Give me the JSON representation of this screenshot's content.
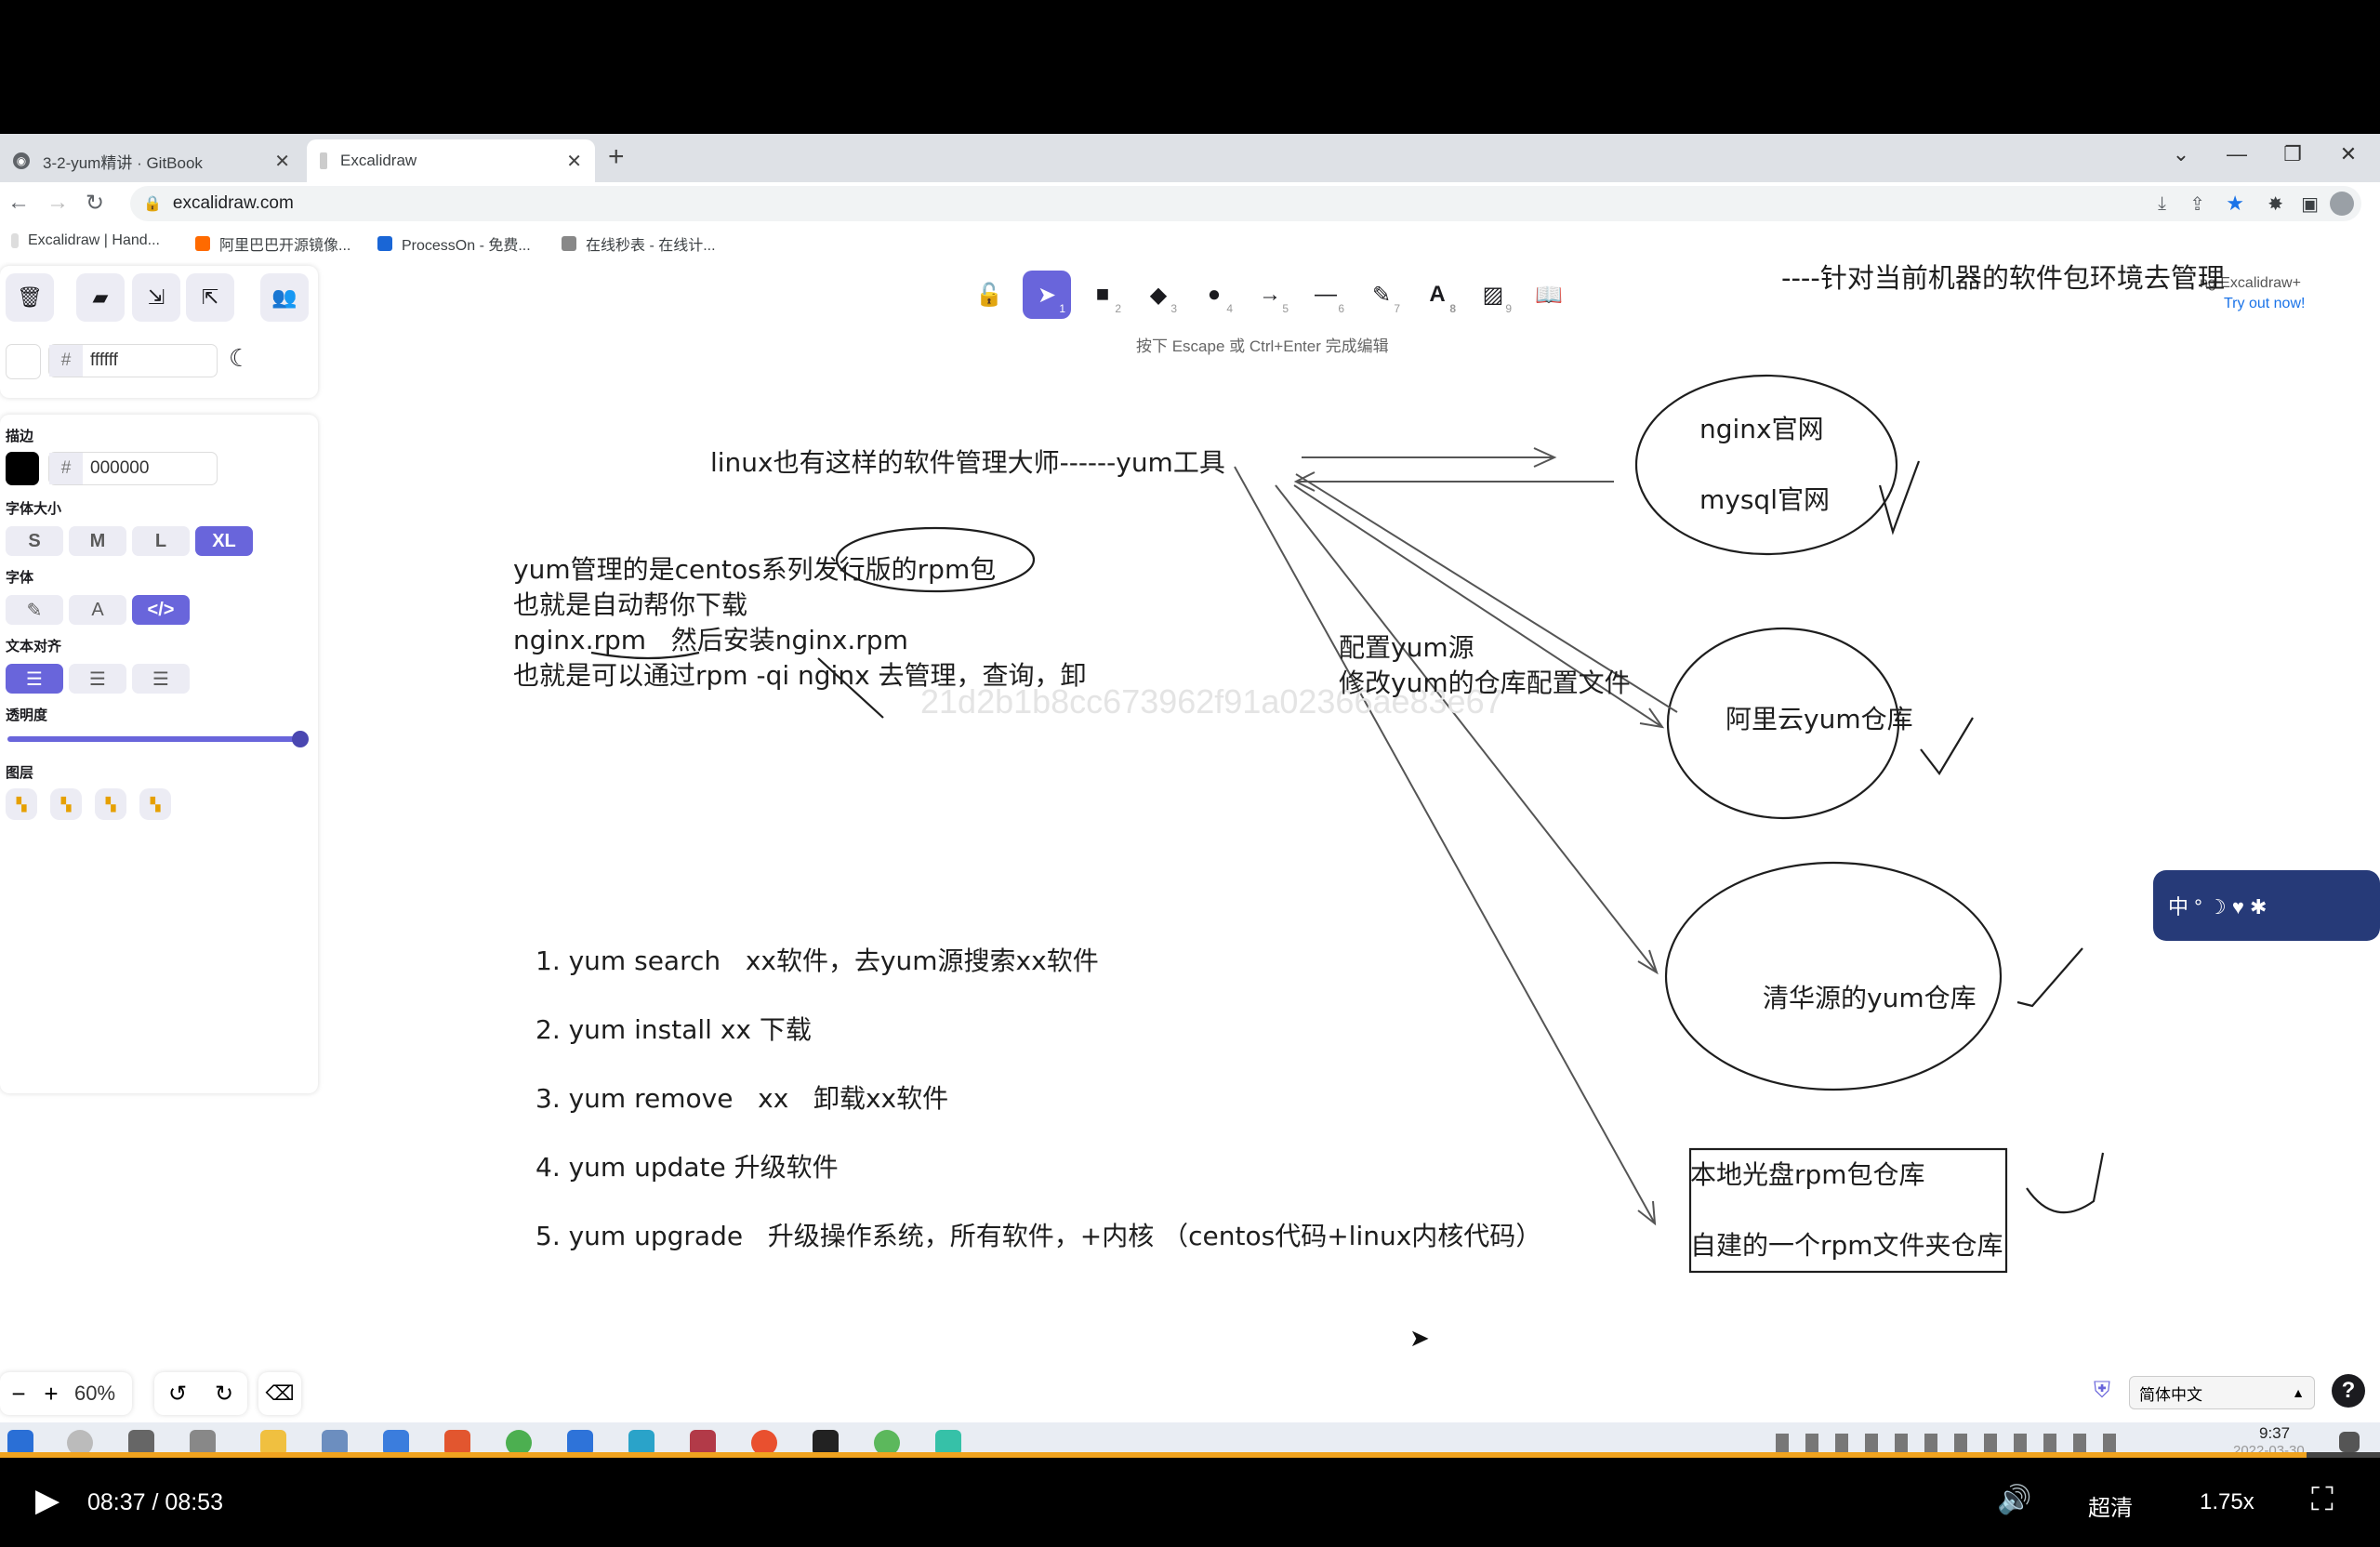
{
  "browser": {
    "tabs": [
      {
        "title": "3-2-yum精讲 · GitBook",
        "active": false
      },
      {
        "title": "Excalidraw",
        "active": true
      }
    ],
    "url": "excalidraw.com",
    "bookmarks": [
      "Excalidraw | Hand...",
      "阿里巴巴开源镜像...",
      "ProcessOn - 免费...",
      "在线秒表 - 在线计..."
    ]
  },
  "excalidraw": {
    "background_hex": "ffffff",
    "panel": {
      "stroke_label": "描边",
      "stroke_hex": "000000",
      "fontsize_label": "字体大小",
      "sizes": [
        "S",
        "M",
        "L",
        "XL"
      ],
      "selected_size": "XL",
      "font_label": "字体",
      "align_label": "文本对齐",
      "opacity_label": "透明度",
      "opacity": 100,
      "layers_label": "图层"
    },
    "hint": "按下 Escape 或 Ctrl+Enter 完成编辑",
    "tool_numbers": [
      "1",
      "2",
      "3",
      "4",
      "5",
      "6",
      "7",
      "8",
      "9"
    ],
    "promo": {
      "line1": "ng Excalidraw+",
      "line2": "Try out now!"
    },
    "zoom": "60%",
    "language": "简体中文"
  },
  "drawing": {
    "top_note": "----针对当前机器的软件包环境去管理",
    "title": "linux也有这样的软件管理大师------yum工具",
    "para": [
      "yum管理的是centos系列发行版的rpm包",
      "也就是自动帮你下载",
      "nginx.rpm   然后安装nginx.rpm",
      "也就是可以通过rpm -qi nginx 去管理，查询，卸"
    ],
    "watermark": "21d2b1b8cc673962f91a02366ae83e67",
    "config": [
      "配置yum源",
      "修改yum的仓库配置文件"
    ],
    "official": [
      "nginx官网",
      "mysql官网"
    ],
    "aliyun": "阿里云yum仓库",
    "tsinghua": "清华源的yum仓库",
    "local": [
      "本地光盘rpm包仓库",
      "自建的一个rpm文件夹仓库"
    ],
    "commands": [
      "1. yum search   xx软件，去yum源搜索xx软件",
      "2. yum install xx 下载",
      "3. yum remove   xx   卸载xx软件",
      "4. yum update 升级软件",
      "5. yum upgrade   升级操作系统，所有软件，+内核 （centos代码+linux内核代码）"
    ]
  },
  "ime": {
    "text": "中 ° ☽ ♥ ✱"
  },
  "taskbar": {
    "time": "9:37",
    "date": "2022-03-30"
  },
  "player": {
    "current": "08:37",
    "sep": "/",
    "total": "08:53",
    "progress": 0.969,
    "quality": "超清",
    "speed": "1.75x"
  }
}
